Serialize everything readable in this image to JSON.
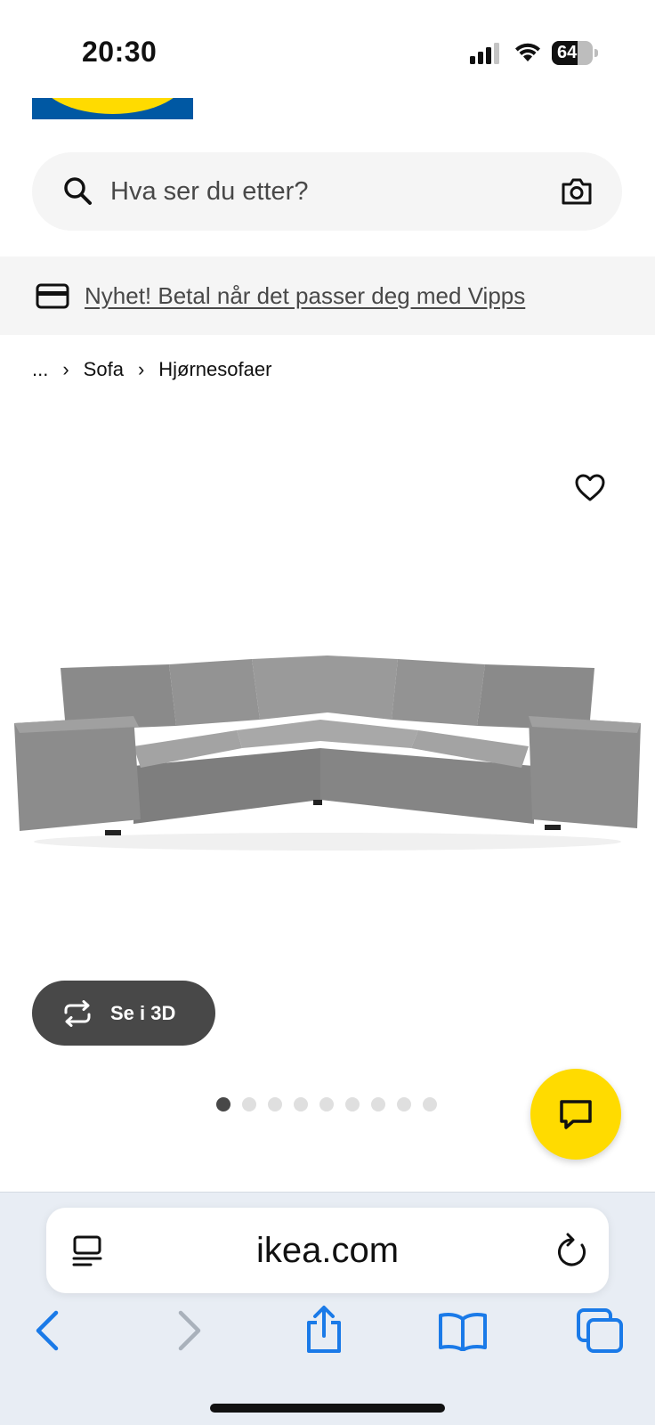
{
  "status_bar": {
    "time": "20:30",
    "battery_level": "64",
    "battery_fraction": 0.64
  },
  "search": {
    "placeholder": "Hva ser du etter?"
  },
  "banner": {
    "link_text": "Nyhet! Betal når det passer deg med Vipps"
  },
  "breadcrumb": {
    "ellipsis": "...",
    "items": [
      "Sofa",
      "Hjørnesofaer"
    ],
    "separator": "›"
  },
  "product": {
    "view_3d_label": "Se i 3D",
    "image_count": 9,
    "active_image_index": 0
  },
  "browser": {
    "url": "ikea.com"
  },
  "colors": {
    "ikea_blue": "#0058a3",
    "ikea_yellow": "#ffdb00",
    "safari_blue": "#1a7ae8"
  },
  "icons": [
    "search-icon",
    "camera-icon",
    "card-icon",
    "heart-icon",
    "rotate-3d-icon",
    "chat-icon",
    "reader-icon",
    "reload-icon",
    "back-icon",
    "forward-icon",
    "share-icon",
    "bookmarks-icon",
    "tabs-icon"
  ]
}
